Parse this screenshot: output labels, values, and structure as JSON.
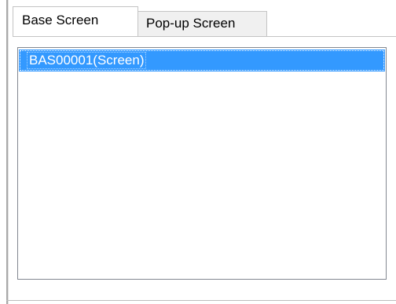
{
  "tabs": [
    {
      "label": "Base Screen",
      "active": true
    },
    {
      "label": "Pop-up Screen",
      "active": false
    }
  ],
  "list": {
    "items": [
      {
        "label": "BAS00001(Screen)",
        "selected": true
      }
    ]
  },
  "colors": {
    "selection": "#3399ff",
    "selection_text": "#ffffff",
    "tab_border": "#c4c4c4",
    "inactive_tab_bg": "#f0f0f0"
  }
}
